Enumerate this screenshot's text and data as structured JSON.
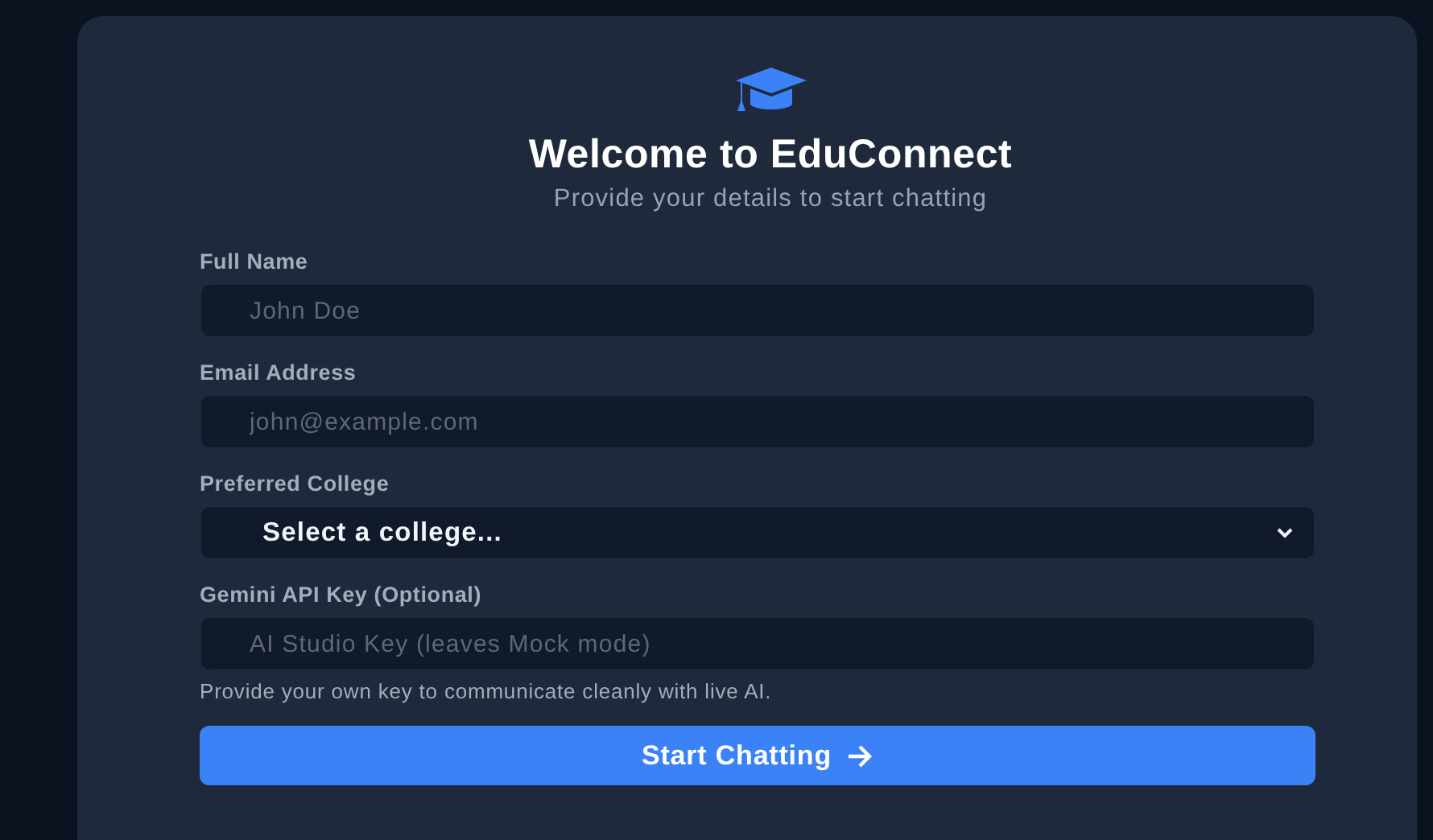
{
  "header": {
    "title": "Welcome to EduConnect",
    "subtitle": "Provide your details to start chatting"
  },
  "fields": [
    {
      "kind": "input",
      "label": "Full Name",
      "placeholder": "John Doe"
    },
    {
      "kind": "input",
      "label": "Email Address",
      "placeholder": "john@example.com"
    },
    {
      "kind": "select",
      "label": "Preferred College",
      "value": "Select a college..."
    },
    {
      "kind": "input",
      "label": "Gemini API Key (Optional)",
      "placeholder": "AI Studio Key (leaves Mock mode)",
      "hint": "Provide your own key to communicate cleanly with live AI."
    }
  ],
  "submit_button": {
    "label": "Start Chatting"
  }
}
